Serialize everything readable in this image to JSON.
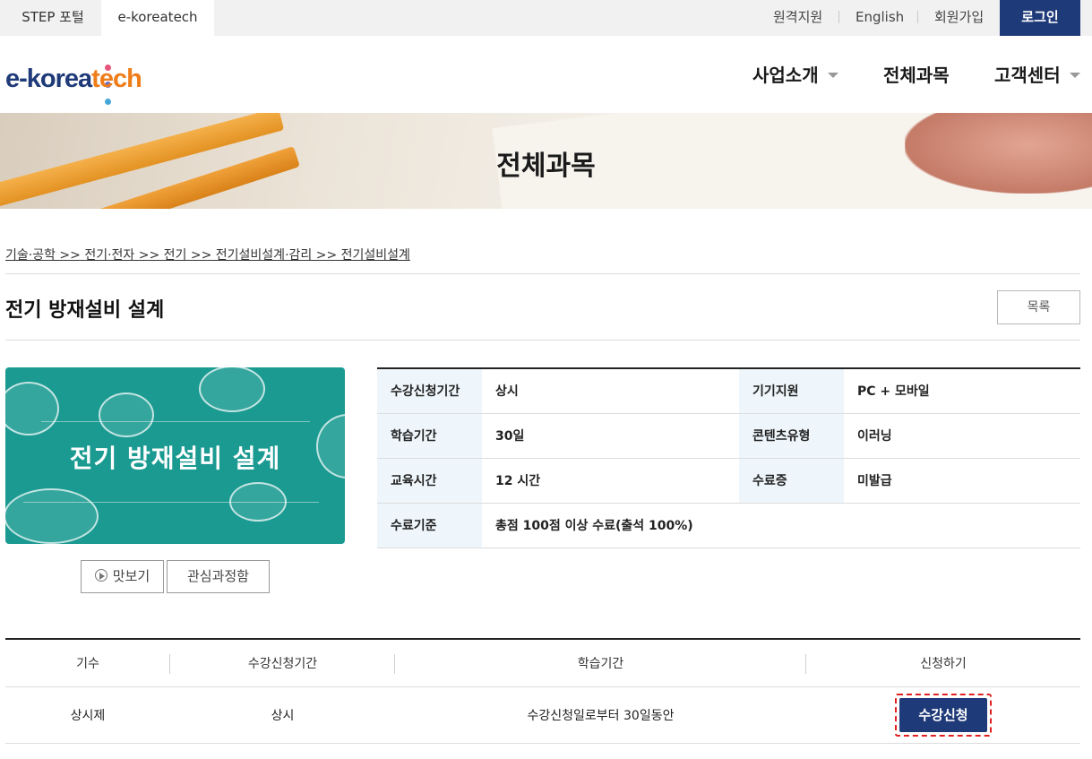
{
  "topbar": {
    "tab_step": "STEP 포털",
    "tab_active": "e-koreatech",
    "remote": "원격지원",
    "english": "English",
    "signup": "회원가입",
    "login": "로그인"
  },
  "logo": {
    "part1": "e-korea",
    "part2": "tech",
    "dot_colors": [
      "#e4567a",
      "#6b6fc4",
      "#46a6d6",
      "#8bc34a"
    ]
  },
  "gnb": {
    "item1": "사업소개",
    "item2": "전체과목",
    "item3": "고객센터"
  },
  "banner": {
    "title": "전체과목"
  },
  "breadcrumb": "기술·공학 >> 전기·전자 >> 전기 >> 전기설비설계·감리 >> 전기설비설계",
  "course": {
    "title": "전기 방재설비 설계",
    "list_button": "목록",
    "thumb_title": "전기 방재설비 설계",
    "preview_button": "맛보기",
    "wishlist_button": "관심과정함"
  },
  "info": {
    "rows": [
      {
        "k1": "수강신청기간",
        "v1": "상시",
        "k2": "기기지원",
        "v2": "PC + 모바일"
      },
      {
        "k1": "학습기간",
        "v1": "30일",
        "k2": "콘텐츠유형",
        "v2": "이러닝"
      },
      {
        "k1": "교육시간",
        "v1": "12 시간",
        "k2": "수료증",
        "v2": "미발급"
      },
      {
        "k1": "수료기준",
        "v1": "총점 100점 이상 수료(출석 100%)"
      }
    ]
  },
  "schedule": {
    "headers": [
      "기수",
      "수강신청기간",
      "학습기간",
      "신청하기"
    ],
    "row": {
      "term": "상시제",
      "period": "상시",
      "duration": "수강신청일로부터 30일동안",
      "apply": "수강신청"
    }
  },
  "colors": {
    "brand": "#1f3a78",
    "accent": "#ee7d1a",
    "thumb": "#1a9a91",
    "highlight": "#e02020"
  }
}
